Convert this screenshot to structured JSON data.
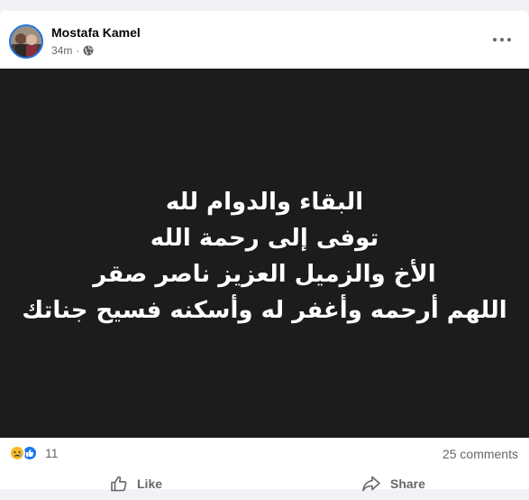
{
  "post": {
    "author": "Mostafa Kamel",
    "time": "34m",
    "separator": "·",
    "privacy_icon": "globe-icon",
    "more_icon": "more-options-icon",
    "image_text": [
      "البقاء والدوام لله",
      "توفى إلى رحمة الله",
      "الأخ والزميل العزيز ناصر صقر",
      "اللهم أرحمه وأغفر له وأسكنه فسيح جناتك"
    ]
  },
  "stats": {
    "reaction_icons": [
      "sad-reaction-icon",
      "like-reaction-icon"
    ],
    "reactions_count": "11",
    "comments": "25 comments"
  },
  "actions": {
    "like_label": "Like",
    "share_label": "Share"
  },
  "colors": {
    "accent": "#1877f2",
    "image_bg": "#1c1c1c",
    "secondary_text": "#65676b"
  }
}
